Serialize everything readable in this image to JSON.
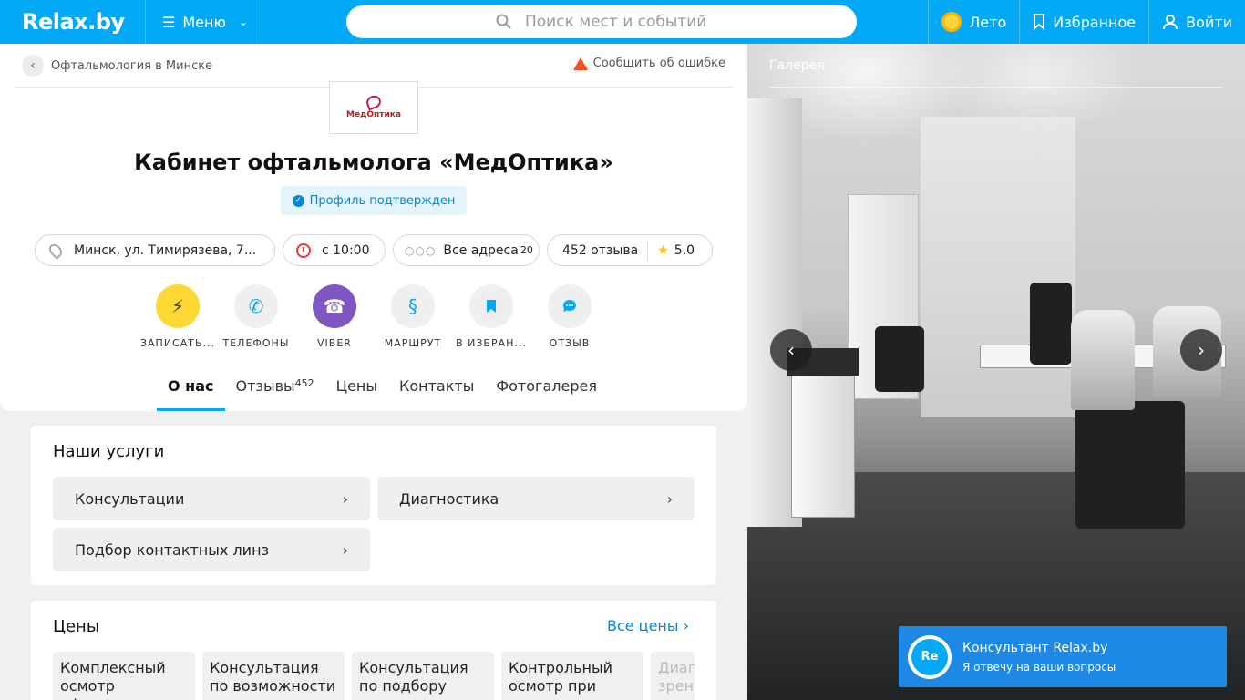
{
  "header": {
    "logo": "Relax.by",
    "menu_label": "Меню",
    "search_placeholder": "Поиск мест и событий",
    "season_label": "Лето",
    "favorites_label": "Избранное",
    "login_label": "Войти"
  },
  "breadcrumb": {
    "back_label": "Офтальмология в Минске",
    "report_label": "Сообщить об ошибке"
  },
  "profile": {
    "logo_text": "МедОптика",
    "title": "Кабинет офтальмолога «МедОптика»",
    "verified_label": "Профиль подтвержден",
    "address": "Минск, ул. Тимирязева, 7...",
    "hours": "с 10:00",
    "all_addresses_label": "Все адреса",
    "all_addresses_count": "20",
    "reviews_count_label": "452 отзыва",
    "rating": "5.0"
  },
  "actions": [
    {
      "label": "ЗАПИСАТЬ...",
      "icon": "lightning-icon",
      "color": "#fdd835"
    },
    {
      "label": "ТЕЛЕФОНЫ",
      "icon": "phone-icon",
      "color": "#efefef"
    },
    {
      "label": "VIBER",
      "icon": "viber-icon",
      "color": "#7e57c2"
    },
    {
      "label": "МАРШРУТ",
      "icon": "route-icon",
      "color": "#efefef"
    },
    {
      "label": "В ИЗБРАН...",
      "icon": "bookmark-icon",
      "color": "#efefef"
    },
    {
      "label": "ОТЗЫВ",
      "icon": "comment-icon",
      "color": "#efefef"
    }
  ],
  "tabs": [
    {
      "label": "О нас",
      "active": true
    },
    {
      "label": "Отзывы",
      "count": "452"
    },
    {
      "label": "Цены"
    },
    {
      "label": "Контакты"
    },
    {
      "label": "Фотогалерея"
    }
  ],
  "services": {
    "title": "Наши услуги",
    "items": [
      "Консультации",
      "Диагностика",
      "Подбор контактных линз"
    ]
  },
  "prices": {
    "title": "Цены",
    "all_label": "Все цены",
    "items": [
      "Комплексный осмотр офтальмолога",
      "Консультация по возможности",
      "Консультация по подбору жестких",
      "Контрольный осмотр при",
      "Диагностика зрения"
    ]
  },
  "gallery": {
    "label": "Галерея"
  },
  "consultant": {
    "avatar_text": "Re",
    "title": "Консультант Relax.by",
    "subtitle": "Я отвечу на ваши вопросы"
  },
  "colors": {
    "brand": "#03a9f4",
    "link": "#0288d1",
    "accent_yellow": "#fdd835",
    "viber": "#7e57c2"
  }
}
